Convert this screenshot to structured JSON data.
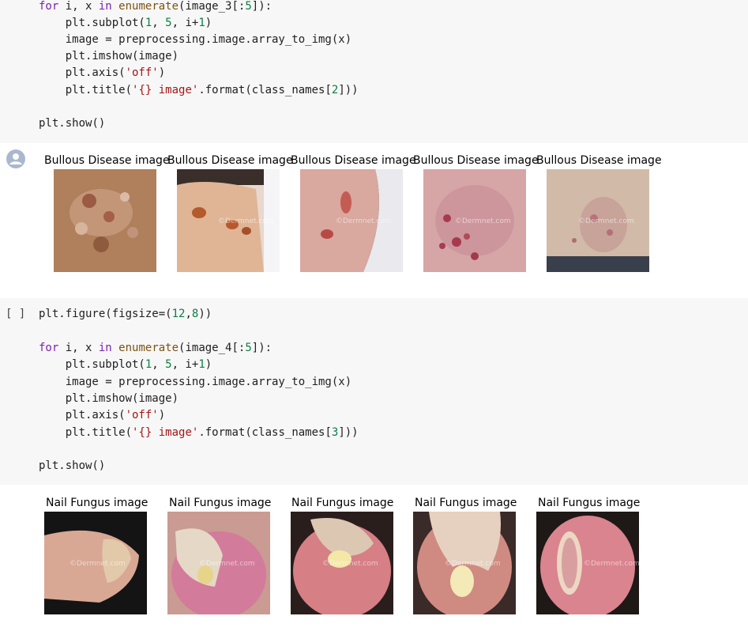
{
  "cell1": {
    "lines": [
      "for i, x in enumerate(image_3[:5]):",
      "    plt.subplot(1, 5, i+1)",
      "    image = preprocessing.image.array_to_img(x)",
      "    plt.imshow(image)",
      "    plt.axis('off')",
      "    plt.title('{} image'.format(class_names[2]))",
      "",
      "plt.show()"
    ]
  },
  "output1": {
    "titles": [
      "Bullous Disease image",
      "Bullous Disease image",
      "Bullous Disease image",
      "Bullous Disease image",
      "Bullous Disease image"
    ]
  },
  "cell2": {
    "run_marker": "[ ]",
    "lines": [
      "plt.figure(figsize=(12,8))",
      "",
      "for i, x in enumerate(image_4[:5]):",
      "    plt.subplot(1, 5, i+1)",
      "    image = preprocessing.image.array_to_img(x)",
      "    plt.imshow(image)",
      "    plt.axis('off')",
      "    plt.title('{} image'.format(class_names[3]))",
      "",
      "plt.show()"
    ]
  },
  "output2": {
    "titles": [
      "Nail Fungus image",
      "Nail Fungus image",
      "Nail Fungus image",
      "Nail Fungus image",
      "Nail Fungus image"
    ],
    "watermark": "©Dermnet.com"
  },
  "colors": {
    "cell_bg": "#f7f7f7",
    "keyword": "#7c1fb3",
    "builtin": "#7c5310",
    "number": "#0b8043",
    "string": "#a31515"
  }
}
